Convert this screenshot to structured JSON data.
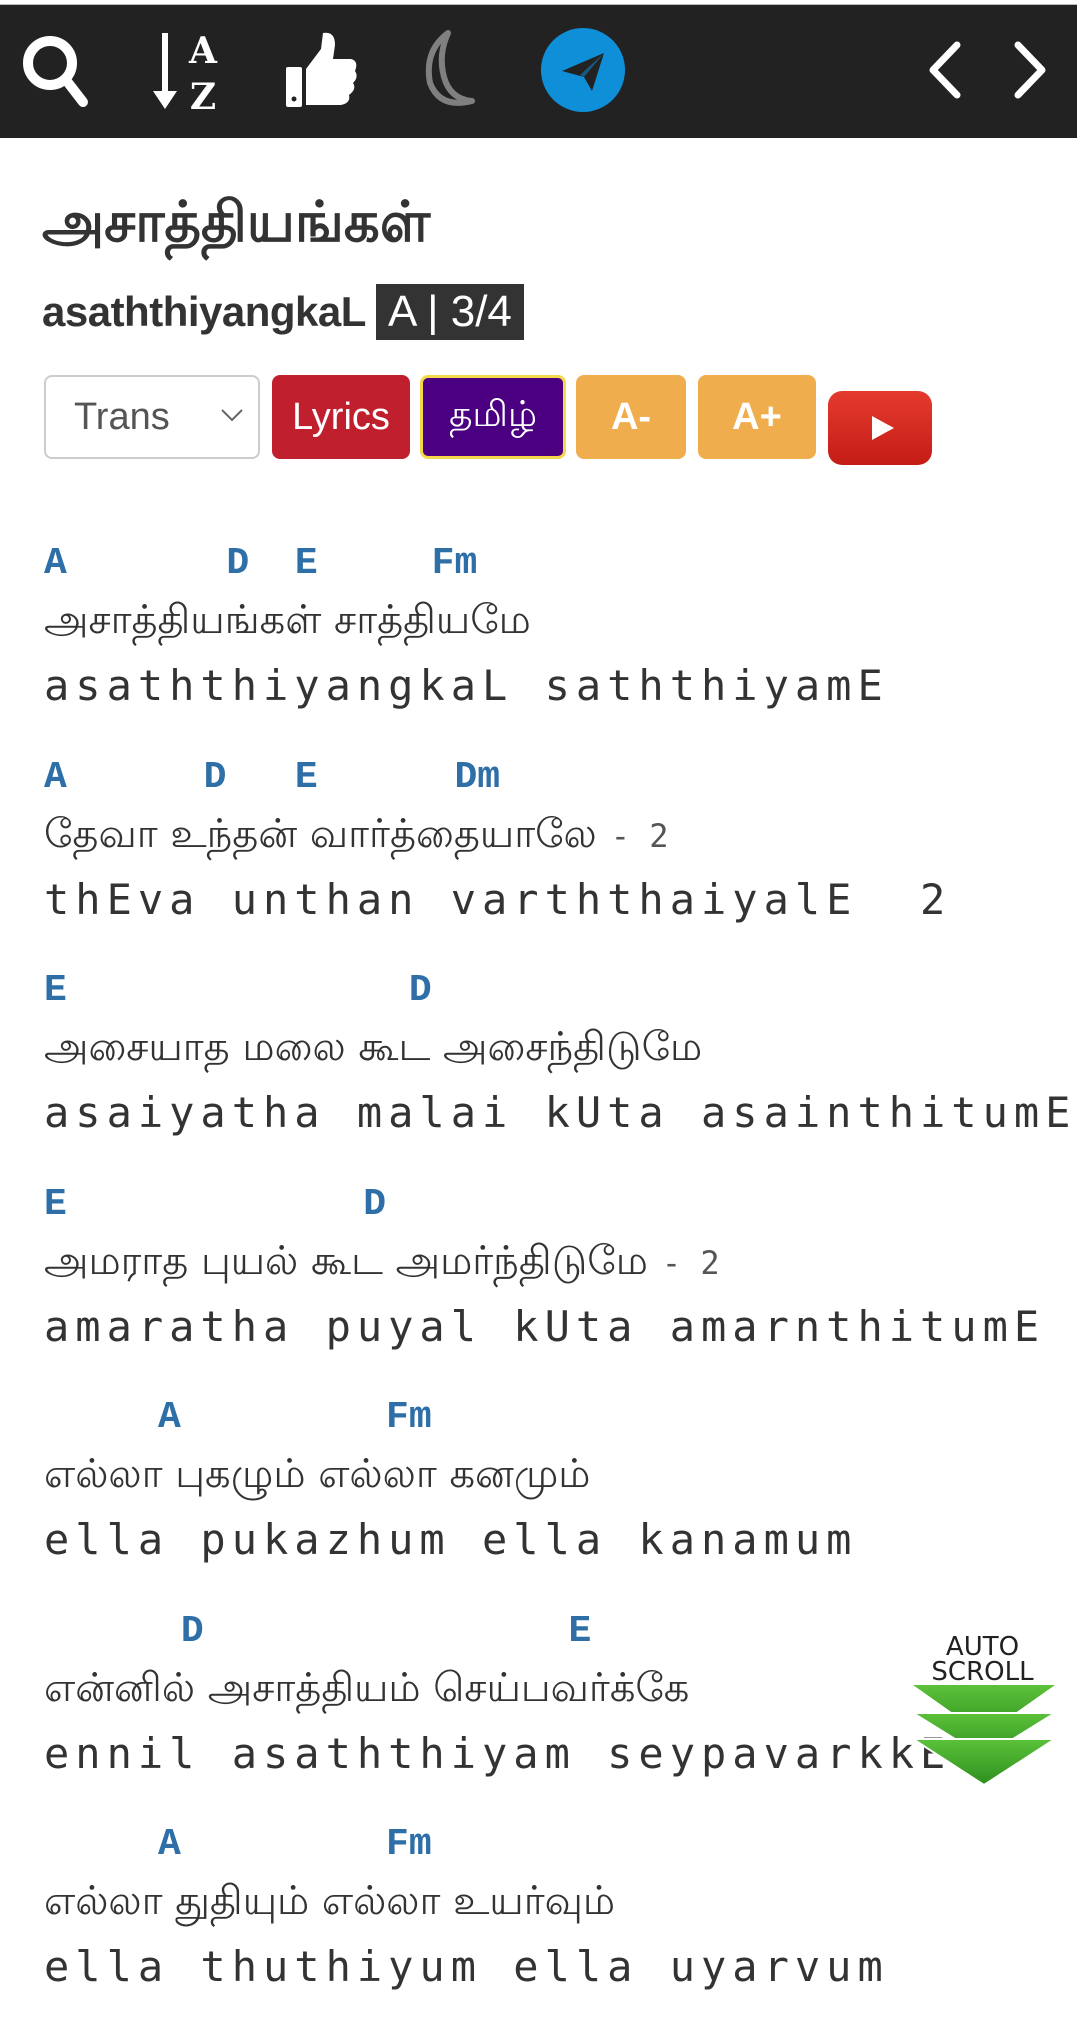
{
  "toolbar": {
    "icons": [
      "search-icon",
      "sort-az-icon",
      "thumbs-up-icon",
      "moon-icon",
      "telegram-icon",
      "chevron-left-icon",
      "chevron-right-icon"
    ],
    "sort_top_letter": "A",
    "sort_bottom_letter": "Z",
    "telegram_color": "#0e8fd8"
  },
  "song": {
    "title_tamil": "அசாத்தியங்கள்",
    "title_transliterated": "asaththiyangkaL",
    "key_badge": "A | 3/4"
  },
  "controls": {
    "script_select": {
      "selected": "Trans"
    },
    "lyrics_label": "Lyrics",
    "tamil_label": "தமிழ்",
    "font_decrease_label": "A-",
    "font_increase_label": "A+",
    "youtube_icon": "youtube-play-icon",
    "colors": {
      "lyrics": "#c0202e",
      "tamil": "#4b0082",
      "font": "#f0ad4e",
      "youtube": "#d8251d"
    }
  },
  "verses": [
    {
      "chords": "A       D  E     Fm",
      "tamil": "அசாத்தியங்கள் சாத்தியமே",
      "repeat": "",
      "trans": "asaththiyangkaL saththiyamE"
    },
    {
      "chords": "A      D   E      Dm",
      "tamil": "தேவா உந்தன் வார்த்தையாலே",
      "repeat": "- 2",
      "trans": "thEva unthan varththaiyalE  2"
    },
    {
      "chords": "E               D",
      "tamil": "அசையாத மலை கூட அசைந்திடுமே",
      "repeat": "",
      "trans": "asaiyatha malai kUta asainthitumE"
    },
    {
      "chords": "E             D",
      "tamil": "அமராத புயல் கூட அமர்ந்திடுமே",
      "repeat": "- 2",
      "trans": "amaratha puyal kUta amarnthitumE"
    },
    {
      "chords": "     A         Fm",
      "tamil": "எல்லா புகழும் எல்லா கனமும்",
      "repeat": "",
      "trans": "ella pukazhum ella kanamum"
    },
    {
      "chords": "      D                E",
      "tamil": "என்னில் அசாத்தியம் செய்பவர்க்கே",
      "repeat": "",
      "trans": "ennil asaththiyam seypavarkkE"
    },
    {
      "chords": "     A         Fm",
      "tamil": "எல்லா துதியும் எல்லா உயர்வும்",
      "repeat": "",
      "trans": "ella thuthiyum ella uyarvum"
    }
  ],
  "autoscroll": {
    "line1": "AUTO",
    "line2": "SCROLL",
    "color": "#3aa82a"
  }
}
